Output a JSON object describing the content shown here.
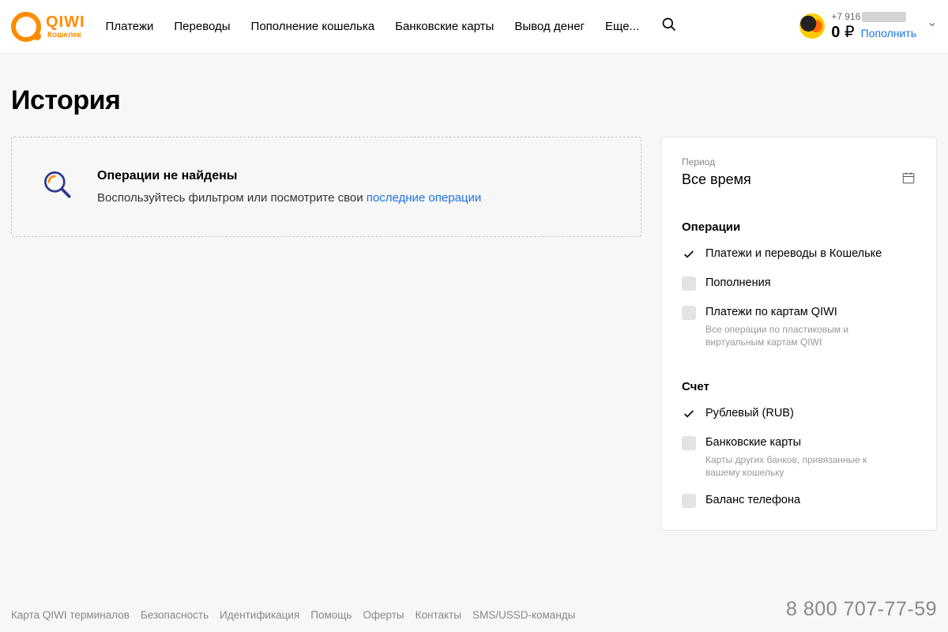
{
  "logo": {
    "brand": "QIWI",
    "sub": "Кошелек"
  },
  "nav": {
    "items": [
      "Платежи",
      "Переводы",
      "Пополнение кошелька",
      "Банковские карты",
      "Вывод денег",
      "Еще..."
    ]
  },
  "account": {
    "phone_prefix": "+7 916",
    "balance_value": "0",
    "currency_symbol": "₽",
    "topup_label": "Пополнить"
  },
  "page": {
    "title": "История"
  },
  "empty": {
    "title": "Операции не найдены",
    "desc_text": "Воспользуйтесь фильтром или посмотрите свои ",
    "desc_link": "последние операции"
  },
  "filter": {
    "period_label": "Период",
    "period_value": "Все время",
    "operations": {
      "heading": "Операции",
      "items": [
        {
          "label": "Платежи и переводы в Кошельке",
          "checked": true
        },
        {
          "label": "Пополнения",
          "checked": false
        },
        {
          "label": "Платежи по картам QIWI",
          "sub": "Все операции по пластиковым и виртуальным картам QIWI",
          "checked": false
        }
      ]
    },
    "account_section": {
      "heading": "Счет",
      "items": [
        {
          "label": "Рублевый (RUB)",
          "checked": true
        },
        {
          "label": "Банковские карты",
          "sub": "Карты других банков, привязанные к вашему кошельку",
          "checked": false
        },
        {
          "label": "Баланс телефона",
          "checked": false
        }
      ]
    }
  },
  "footer": {
    "links": [
      "Карта QIWI терминалов",
      "Безопасность",
      "Идентификация",
      "Помощь",
      "Оферты",
      "Контакты",
      "SMS/USSD-команды"
    ],
    "phone": "8 800 707-77-59"
  }
}
